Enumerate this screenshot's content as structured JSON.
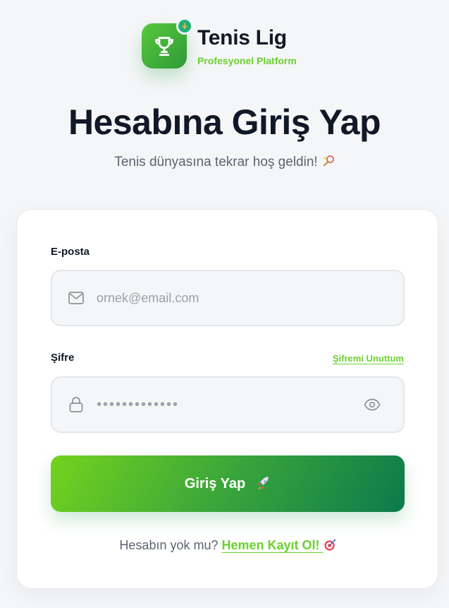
{
  "brand": {
    "name": "Tenis Lig",
    "tagline": "Profesyonel Platform"
  },
  "header": {
    "title": "Hesabına Giriş Yap",
    "subtitle": "Tenis dünyasına tekrar hoş geldin!"
  },
  "form": {
    "email_label": "E-posta",
    "email_placeholder": "ornek@email.com",
    "email_value": "",
    "password_label": "Şifre",
    "password_value": "•••••••••••••",
    "forgot_link": "Şifremi Unuttum",
    "submit_label": "Giriş Yap"
  },
  "footer": {
    "prompt": "Hesabın yok mu?",
    "signup_link": "Hemen Kayıt Ol!"
  },
  "icons": {
    "logo": "trophy-icon",
    "badge": "arrow-down-icon",
    "subtitle_emoji": "tennis-racket-icon",
    "email": "mail-icon",
    "password": "lock-icon",
    "toggle": "eye-icon",
    "submit_emoji": "rocket-icon",
    "signup_emoji": "target-icon"
  },
  "colors": {
    "accent_green": "#6ad12f",
    "button_start": "#74d31e",
    "button_end": "#0c7a4c",
    "background": "#f5f6f8"
  }
}
